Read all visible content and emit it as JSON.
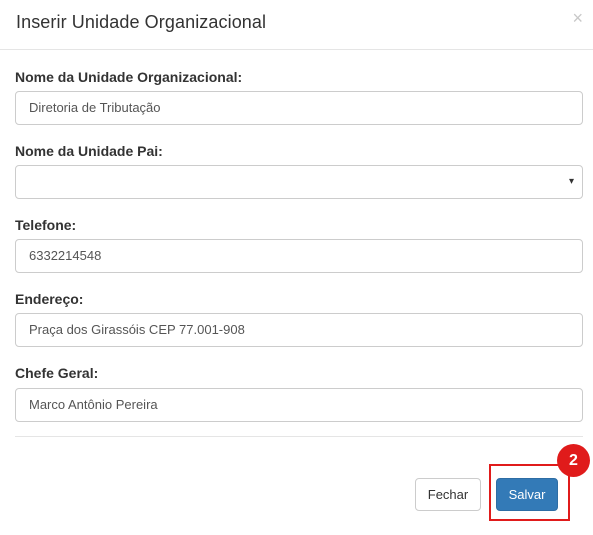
{
  "modal": {
    "title": "Inserir Unidade Organizacional",
    "close_label": "×"
  },
  "form": {
    "nome_unidade": {
      "label": "Nome da Unidade Organizacional:",
      "value": "Diretoria de Tributação"
    },
    "unidade_pai": {
      "label": "Nome da Unidade Pai:",
      "value": "",
      "caret": "▾"
    },
    "telefone": {
      "label": "Telefone:",
      "value": "6332214548"
    },
    "endereco": {
      "label": "Endereço:",
      "value": "Praça dos Girassóis CEP 77.001-908"
    },
    "chefe_geral": {
      "label": "Chefe Geral:",
      "value": "Marco Antônio Pereira"
    }
  },
  "footer": {
    "fechar_label": "Fechar",
    "salvar_label": "Salvar"
  },
  "annotation": {
    "step_number": "2",
    "highlight_color": "#e01b1b"
  },
  "colors": {
    "primary": "#337ab7",
    "border": "#cccccc",
    "divider": "#e5e5e5",
    "text": "#333333"
  }
}
